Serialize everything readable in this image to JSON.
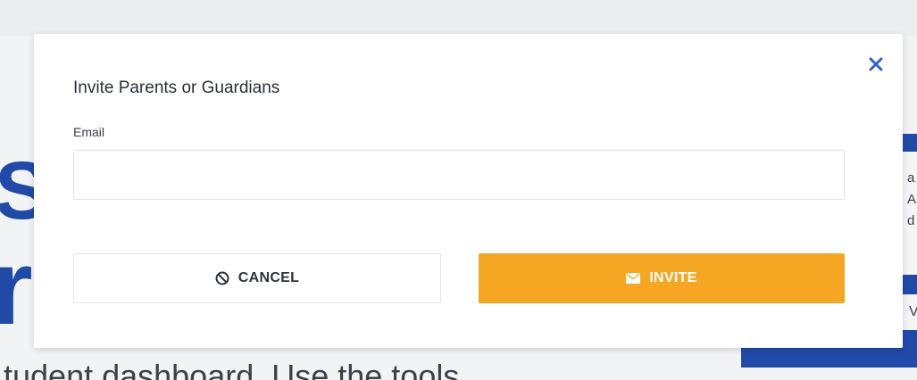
{
  "background": {
    "heading_fragment_1": "S",
    "heading_fragment_2": "r",
    "side_panel_lines": [
      "a",
      "A",
      "d"
    ],
    "side_panel_button": "V",
    "bottom_text": "tudent dashboard. Use the tools"
  },
  "dialog": {
    "title": "Invite Parents or Guardians",
    "close_icon": "close-icon",
    "email": {
      "label": "Email",
      "value": "",
      "placeholder": ""
    },
    "cancel_button": {
      "label": "CANCEL",
      "icon": "ban-icon"
    },
    "invite_button": {
      "label": "INVITE",
      "icon": "envelope-icon"
    }
  },
  "colors": {
    "accent_orange": "#f5a623",
    "brand_blue": "#1f4aa8",
    "close_blue": "#2f5fcf"
  }
}
